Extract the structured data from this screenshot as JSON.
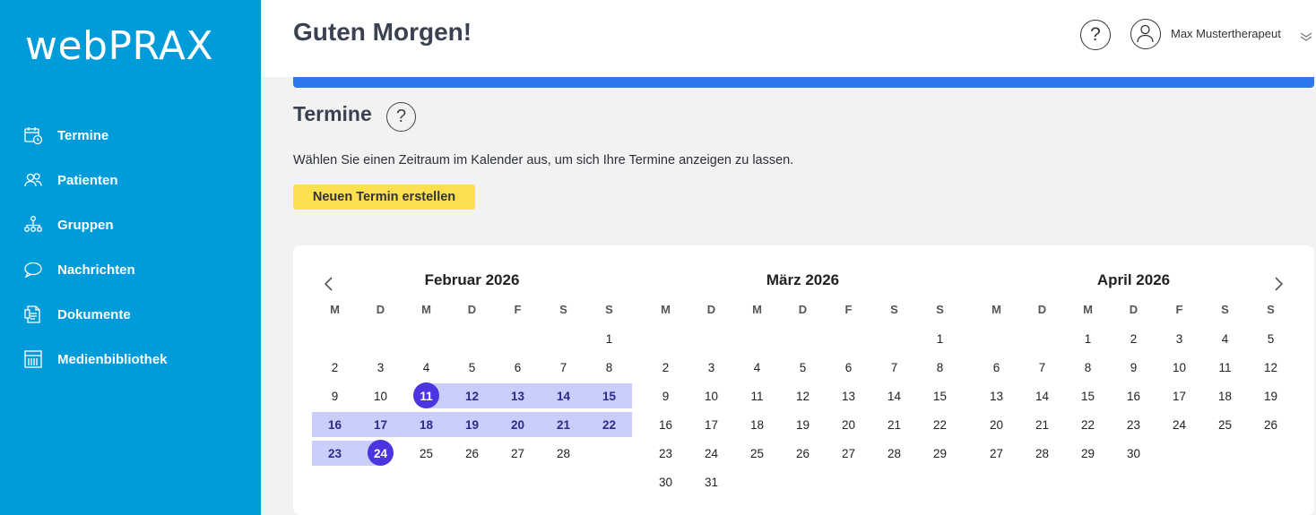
{
  "app": {
    "logo": "webPRAX"
  },
  "sidebar": {
    "items": [
      {
        "label": "Termine",
        "icon": "calendar-clock-icon"
      },
      {
        "label": "Patienten",
        "icon": "users-icon"
      },
      {
        "label": "Gruppen",
        "icon": "group-hierarchy-icon"
      },
      {
        "label": "Nachrichten",
        "icon": "chat-bubble-icon"
      },
      {
        "label": "Dokumente",
        "icon": "document-icon"
      },
      {
        "label": "Medienbibliothek",
        "icon": "media-library-icon"
      }
    ]
  },
  "header": {
    "greeting": "Guten Morgen!",
    "help_icon": "question-circle-icon",
    "user": {
      "name": "Max Mustertherapeut",
      "avatar_icon": "user-avatar-icon",
      "menu_icon": "double-chevron-down-icon"
    }
  },
  "main": {
    "title": "Termine",
    "help_icon": "question-circle-icon",
    "description": "Wählen Sie einen Zeitraum im Kalender aus, um sich Ihre Termine anzeigen zu lassen.",
    "new_button": "Neuen Termin erstellen"
  },
  "calendar": {
    "weekdays": [
      "M",
      "D",
      "M",
      "D",
      "F",
      "S",
      "S"
    ],
    "selection": {
      "month": 0,
      "start": 11,
      "end": 24
    },
    "months": [
      {
        "title": "Februar 2026",
        "offset": 6,
        "days": 28
      },
      {
        "title": "März 2026",
        "offset": 6,
        "days": 31
      },
      {
        "title": "April 2026",
        "offset": 2,
        "days": 30
      }
    ]
  },
  "colors": {
    "sidebar": "#009cda",
    "accent_bar": "#2e77f0",
    "button": "#fde050",
    "range": "#c9cefa",
    "endpoint": "#4a35e0"
  }
}
